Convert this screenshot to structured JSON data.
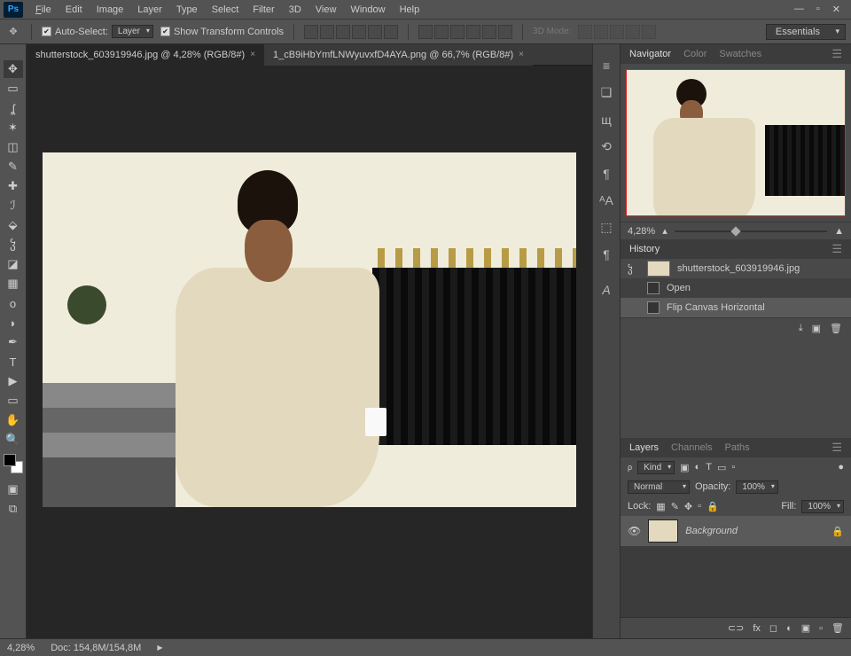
{
  "app": {
    "logo": "Ps"
  },
  "menu": {
    "file": "File",
    "edit": "Edit",
    "image": "Image",
    "layer": "Layer",
    "type": "Type",
    "select": "Select",
    "filter": "Filter",
    "threeD": "3D",
    "view": "View",
    "window": "Window",
    "help": "Help"
  },
  "options": {
    "autoSelect": "Auto-Select:",
    "autoSelectTarget": "Layer",
    "showTransform": "Show Transform Controls",
    "threeDMode": "3D Mode:",
    "workspace": "Essentials"
  },
  "tabs": [
    {
      "label": "shutterstock_603919946.jpg @ 4,28% (RGB/8#)",
      "active": true
    },
    {
      "label": "1_cB9iHbYmfLNWyuvxfD4AYA.png @ 66,7% (RGB/8#)",
      "active": false
    }
  ],
  "panels": {
    "nav": {
      "tabs": [
        "Navigator",
        "Color",
        "Swatches"
      ],
      "active": 0,
      "zoom": "4,28%"
    },
    "history": {
      "title": "History",
      "doc": "shutterstock_603919946.jpg",
      "items": [
        "Open",
        "Flip Canvas Horizontal"
      ],
      "selected": 1
    },
    "layers": {
      "tabs": [
        "Layers",
        "Channels",
        "Paths"
      ],
      "active": 0,
      "kindLabel": "Kind",
      "blend": "Normal",
      "opacityLabel": "Opacity:",
      "opacity": "100%",
      "lockLabel": "Lock:",
      "fillLabel": "Fill:",
      "fill": "100%",
      "layer": {
        "name": "Background"
      }
    }
  },
  "status": {
    "zoom": "4,28%",
    "doc": "Doc: 154,8M/154,8M"
  }
}
